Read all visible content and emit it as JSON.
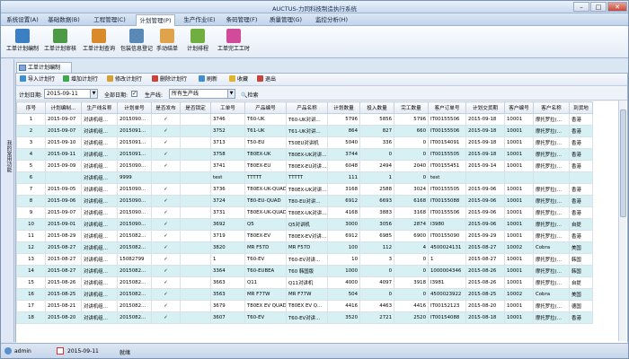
{
  "window": {
    "title": "AUCTUS-力同科技制造执行系统",
    "min": "–",
    "max": "□",
    "close": "✕"
  },
  "menu": [
    "系统设置(A)",
    "基础数据(B)",
    "工程管理(C)",
    "计划管理(P)",
    "生产作业(E)",
    "条码管理(F)",
    "质量管理(G)",
    "监控分析(H)"
  ],
  "menu_active": 3,
  "ribbon": [
    {
      "label": "工单计划编制",
      "icon": "plan-edit-icon",
      "color": "#3b7fc4"
    },
    {
      "label": "工单计划审核",
      "icon": "plan-review-icon",
      "color": "#4c9a45"
    },
    {
      "label": "工单计划查询",
      "icon": "plan-query-icon",
      "color": "#d98a2b"
    },
    {
      "label": "包装信息登记",
      "icon": "package-register-icon",
      "color": "#5a89b8"
    },
    {
      "label": "手动结单",
      "icon": "manual-close-icon",
      "color": "#e0a24a"
    },
    {
      "label": "计划排程",
      "icon": "schedule-icon",
      "color": "#6fae3f"
    },
    {
      "label": "工单完工工时",
      "icon": "clock-icon",
      "color": "#d14b9a"
    }
  ],
  "left_strip": "我的常用功能",
  "doc_tab": "工单计划编制",
  "toolbar": [
    "导入计划行",
    "增加计划行",
    "修改计划行",
    "删除计划行",
    "刷新",
    "收藏",
    "退出"
  ],
  "filter": {
    "date_label": "计划日期:",
    "date_value": "2015-09-11",
    "all_dates_label": "全部日期:",
    "line_label": "生产线:",
    "line_value": "所有生产线",
    "search_label": "检索"
  },
  "columns": [
    "序号",
    "计划编制…",
    "生产线名称",
    "计划单号",
    "是否发布",
    "是否锁定",
    "工单号",
    "产品编号",
    "产品名称",
    "计划数量",
    "投入数量",
    "完工数量",
    "客户订单号",
    "计划交货期",
    "客户编号",
    "客户名称",
    "到货地"
  ],
  "rows": [
    [
      "1",
      "2015-09-07",
      "对讲机组…",
      "2015090…",
      "✓",
      "",
      "3746",
      "T60-UK",
      "T60-UK对讲…",
      "5796",
      "5856",
      "5796",
      "IT00155506",
      "2015-09-18",
      "10001",
      "摩托罗拉(…",
      "香港"
    ],
    [
      "2",
      "2015-09-07",
      "对讲机组…",
      "2015091…",
      "✓",
      "",
      "3752",
      "T61-UK",
      "T61-UK对讲…",
      "864",
      "827",
      "660",
      "IT00155506",
      "2015-09-18",
      "10001",
      "摩托罗拉(…",
      "香港"
    ],
    [
      "3",
      "2015-09-10",
      "对讲机组…",
      "2015091…",
      "✓",
      "",
      "3713",
      "T50-EU",
      "T50EU对讲机",
      "5040",
      "336",
      "0",
      "IT00154091",
      "2015-09-18",
      "10001",
      "摩托罗拉(…",
      "香港"
    ],
    [
      "4",
      "2015-09-11",
      "对讲机组…",
      "2015091…",
      "✓",
      "",
      "3758",
      "T80EX-UK",
      "T80EX-UK对讲…",
      "3744",
      "0",
      "0",
      "IT00155505",
      "2015-09-18",
      "10001",
      "摩托罗拉(…",
      "香港"
    ],
    [
      "5",
      "2015-09-09",
      "对讲机组…",
      "2015090…",
      "✓",
      "",
      "3741",
      "T80EX-EU",
      "T80EX-EU对讲…",
      "6048",
      "2494",
      "2040",
      "IT00155451",
      "2015-09-14",
      "10001",
      "摩托罗拉(…",
      "香港"
    ],
    [
      "6",
      "",
      "对讲机组…",
      "9999",
      "",
      "",
      "test",
      "TTTTT",
      "TTTTT",
      "111",
      "1",
      "0",
      "test",
      "",
      "",
      "",
      ""
    ],
    [
      "7",
      "2015-09-05",
      "对讲机组…",
      "2015090…",
      "✓",
      "",
      "3736",
      "T80EX-UK-QUAD",
      "T80EX-UK对讲…",
      "3168",
      "2588",
      "3024",
      "IT00155505",
      "2015-09-06",
      "10001",
      "摩托罗拉(…",
      "香港"
    ],
    [
      "8",
      "2015-09-06",
      "对讲机组…",
      "2015090…",
      "✓",
      "",
      "3724",
      "T80-EU-QUAD",
      "T80-EU对讲…",
      "6912",
      "6693",
      "6168",
      "IT00155088",
      "2015-09-06",
      "10001",
      "摩托罗拉(…",
      "香港"
    ],
    [
      "9",
      "2015-09-07",
      "对讲机组…",
      "2015090…",
      "✓",
      "",
      "3731",
      "T80EX-UK-QUAD",
      "T80EX-UK对讲…",
      "4168",
      "3883",
      "3168",
      "IT00155506",
      "2015-09-06",
      "10001",
      "摩托罗拉(…",
      "香港"
    ],
    [
      "10",
      "2015-09-01",
      "对讲机组…",
      "2015090…",
      "✓",
      "",
      "3692",
      "Q5",
      "Q5对讲机",
      "3000",
      "3056",
      "2874",
      "I3980",
      "2015-09-06",
      "10001",
      "摩托罗拉(…",
      "自提"
    ],
    [
      "11",
      "2015-08-29",
      "对讲机组…",
      "2015082…",
      "✓",
      "",
      "3719",
      "T80EX-EV",
      "T80EX-EV对讲…",
      "6912",
      "6985",
      "6900",
      "IT00155090",
      "2015-09-29",
      "10001",
      "摩托罗拉(…",
      "香港"
    ],
    [
      "12",
      "2015-08-27",
      "对讲机组…",
      "2015082…",
      "✓",
      "",
      "3820",
      "MR F57D",
      "MR F57D",
      "100",
      "112",
      "4",
      "4500024131",
      "2015-08-27",
      "10002",
      "Cobra",
      "美国"
    ],
    [
      "13",
      "2015-08-27",
      "对讲机组…",
      "15082799",
      "✓",
      "",
      "1",
      "T60-EV",
      "T60-EV对讲…",
      "10",
      "3",
      "0",
      "1",
      "2015-08-27",
      "10001",
      "摩托罗拉(…",
      "韩国"
    ],
    [
      "14",
      "2015-08-27",
      "对讲机组…",
      "2015082…",
      "✓",
      "",
      "3364",
      "T60-EUBEA",
      "T60 韩国版",
      "1000",
      "0",
      "0",
      "1000004346",
      "2015-08-26",
      "10001",
      "摩托罗拉(…",
      "韩国"
    ],
    [
      "15",
      "2015-08-26",
      "对讲机组…",
      "2015082…",
      "✓",
      "",
      "3663",
      "Q11",
      "Q11对讲机",
      "4000",
      "4097",
      "3918",
      "I3981",
      "2015-08-26",
      "10001",
      "摩托罗拉(…",
      "自提"
    ],
    [
      "16",
      "2015-08-25",
      "对讲机组…",
      "2015082…",
      "✓",
      "",
      "3563",
      "MR F77W",
      "MR F77W",
      "504",
      "0",
      "0",
      "4500023922",
      "2015-08-25",
      "10002",
      "Cobra",
      "美国"
    ],
    [
      "17",
      "2015-08-21",
      "对讲机组…",
      "2015082…",
      "✓",
      "",
      "3679",
      "T80EX EV QUAD",
      "T80EX EV Q…",
      "4416",
      "4463",
      "4416",
      "IT00152123",
      "2015-08-20",
      "10001",
      "摩托罗拉(…",
      "德国"
    ],
    [
      "18",
      "2015-08-20",
      "对讲机组…",
      "2015082…",
      "✓",
      "",
      "3607",
      "T60-EV",
      "T60-EV对讲…",
      "3520",
      "2721",
      "2520",
      "IT00154088",
      "2015-08-18",
      "10001",
      "摩托罗拉(…",
      "香港"
    ]
  ],
  "status": {
    "user": "admin",
    "date": "2015-09-11",
    "state": "就绪"
  }
}
